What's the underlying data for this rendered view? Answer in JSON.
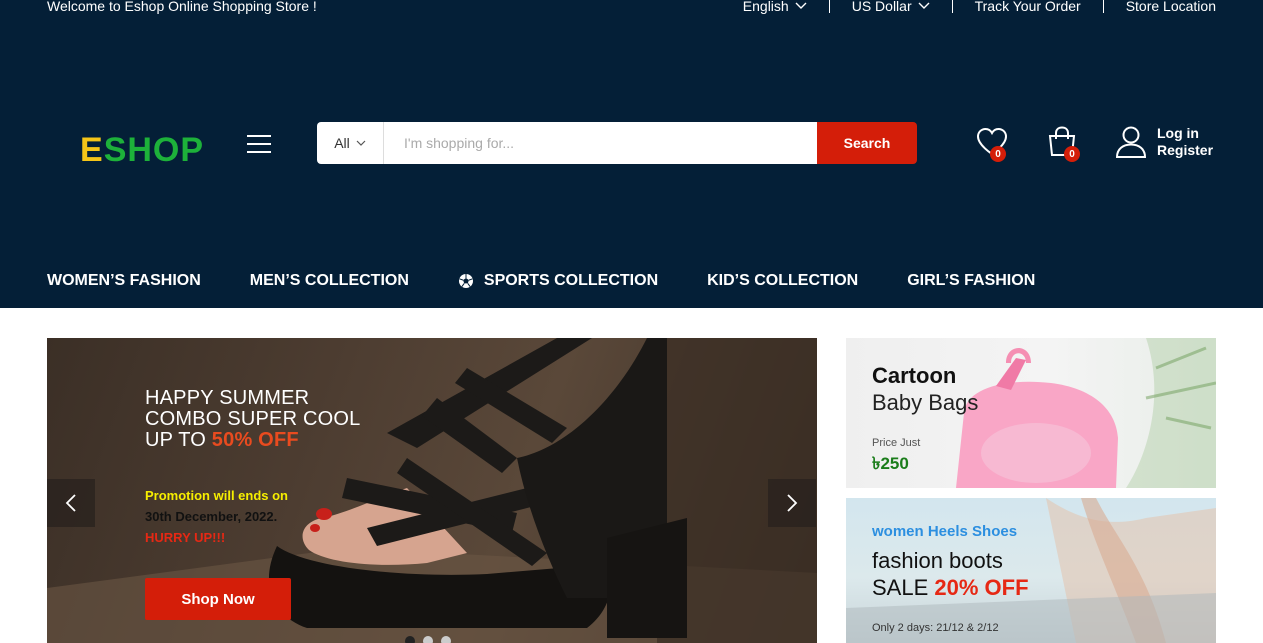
{
  "topbar": {
    "welcome": "Welcome to Eshop Online Shopping Store !",
    "language": "English",
    "currency": "US Dollar",
    "track_order": "Track Your Order",
    "store_location": "Store Location"
  },
  "header": {
    "logo_first": "E",
    "logo_rest": "SHOP",
    "search": {
      "category": "All",
      "placeholder": "I'm shopping for...",
      "button": "Search"
    },
    "wishlist_count": "0",
    "cart_count": "0",
    "account": {
      "login": "Log in",
      "register": "Register"
    }
  },
  "nav": {
    "items": [
      {
        "label": "WOMEN’S FASHION"
      },
      {
        "label": "MEN’S COLLECTION"
      },
      {
        "label": "SPORTS COLLECTION",
        "icon": "soccer-ball-icon"
      },
      {
        "label": "KID’S COLLECTION"
      },
      {
        "label": "GIRL’S FASHION"
      }
    ]
  },
  "hero": {
    "line1": "HAPPY SUMMER",
    "line2": "COMBO SUPER COOL",
    "line3_prefix": "UP TO ",
    "line3_offer": "50% OFF",
    "promo_line1": "Promotion will ends on",
    "promo_line2": "30th December, 2022.",
    "promo_line3": "HURRY UP!!!",
    "button": "Shop Now"
  },
  "banner_bags": {
    "title": "Cartoon",
    "subtitle": "Baby Bags",
    "price_label": "Price Just",
    "price": "৳250"
  },
  "banner_shoes": {
    "tagline": "women Heels Shoes",
    "title": "fashion boots",
    "sale_prefix": "SALE ",
    "sale_offer": "20% OFF",
    "note": "Only 2 days: 21/12 & 2/12"
  },
  "colors": {
    "header_bg": "#041f37",
    "accent_red": "#d41e09",
    "logo_yellow": "#f5c518",
    "logo_green": "#1db13a"
  }
}
